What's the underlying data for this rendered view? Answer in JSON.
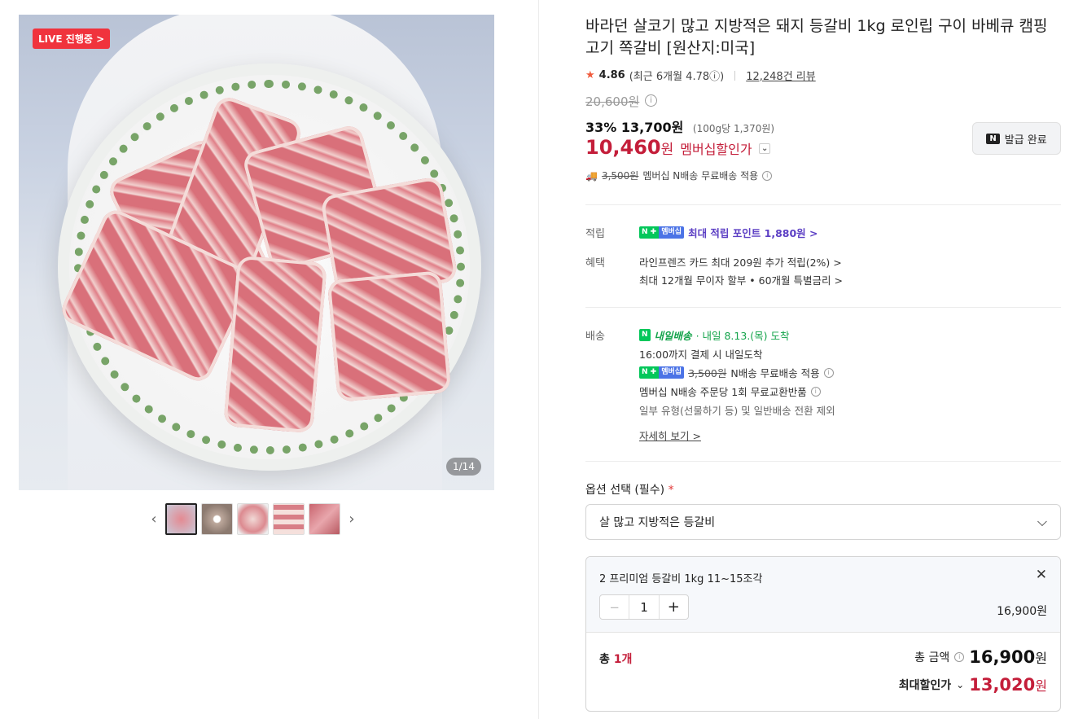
{
  "gallery": {
    "live_badge": "LIVE 진행중 >",
    "counter": "1/14",
    "thumb_count": 5
  },
  "product": {
    "title": "바라던 살코기 많고 지방적은 돼지 등갈비 1kg 로인립 구이 바베큐 캠핑고기 쪽갈비 [원산지:미국]",
    "rating": "4.86",
    "recent_rating": "(최근 6개월 4.78ⓘ)",
    "reviews": "12,248건 리뷰",
    "original_price": "20,600원",
    "discount_pct": "33%",
    "sale_price": "13,700원",
    "unit_price": "(100g당 1,370원)",
    "member_price": "10,460",
    "member_unit": "원",
    "member_label": "멤버십할인가",
    "coupon_button": "발급 완료",
    "shipping_fee": "3,500원",
    "shipping_note": "멤버십 N배송 무료배송 적용"
  },
  "benefits": {
    "points_label": "적립",
    "points_text": "최대 적립 포인트 1,880원 >",
    "benefit_label": "혜택",
    "benefit_1": "라인프렌즈 카드 최대 209원 추가 적립(2%) >",
    "benefit_2": "최대 12개월 무이자 할부 • 60개월 특별금리 >"
  },
  "delivery": {
    "label": "배송",
    "type": "내일배송",
    "arrival": "· 내일 8.13.(목) 도착",
    "cutoff": "16:00까지 결제 시 내일도착",
    "fee": "3,500원",
    "fee_note": "N배송 무료배송 적용",
    "exchange": "멤버십 N배송 주문당 1회 무료교환반품",
    "exclusion": "일부 유형(선물하기 등) 및 일반배송 전환 제외",
    "more": "자세히 보기 >"
  },
  "option": {
    "label": "옵션 선택 (필수)",
    "required_mark": "*",
    "selected": "살 많고 지방적은 등갈비"
  },
  "selection": {
    "item_name": "2 프리미엄 등갈비 1kg 11~15조각",
    "quantity": "1",
    "item_price": "16,900원"
  },
  "total": {
    "count_label": "총 ",
    "count": "1개",
    "amount_label": "총 금액",
    "amount": "16,900",
    "amount_unit": "원",
    "discount_label": "최대할인가",
    "discount_amount": "13,020",
    "discount_unit": "원"
  },
  "colors": {
    "accent_red": "#c41e3a",
    "naver_green": "#03c75a",
    "points_purple": "#5c3fc4"
  }
}
